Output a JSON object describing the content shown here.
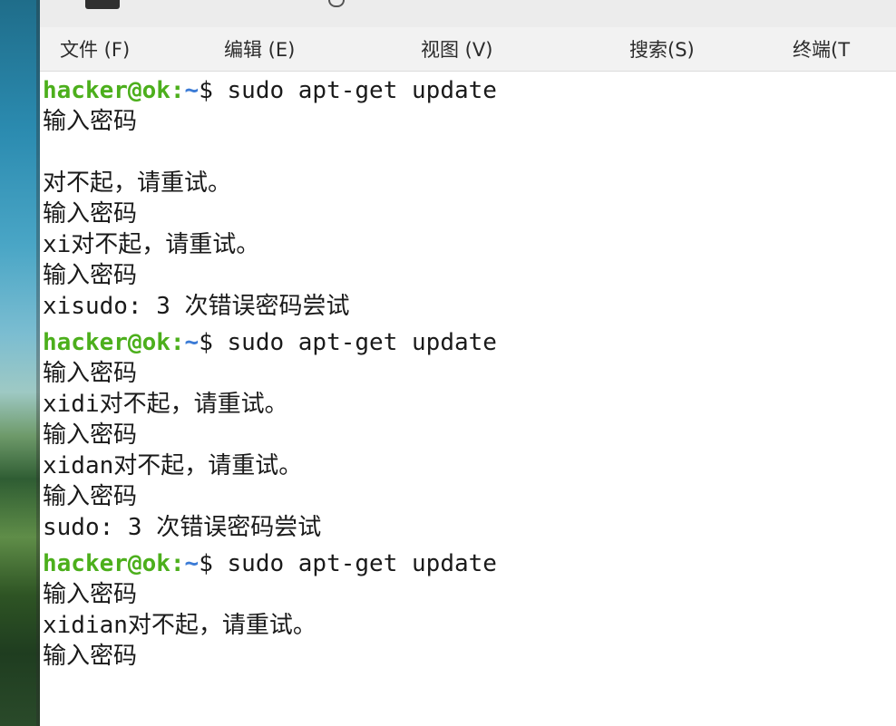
{
  "menubar": {
    "items": [
      {
        "label": "文件 (F)"
      },
      {
        "label": "编辑 (E)"
      },
      {
        "label": "视图 (V)"
      },
      {
        "label": "搜索(S)"
      },
      {
        "label": "终端(T"
      }
    ]
  },
  "terminal": {
    "prompt": {
      "user_host": "hacker@ok",
      "colon": ":",
      "path": "~",
      "sign": "$ "
    },
    "command": "sudo apt-get update",
    "lines": [
      "输入密码",
      "",
      "对不起，请重试。",
      "输入密码",
      "xi对不起，请重试。",
      "输入密码",
      "xisudo: 3 次错误密码尝试",
      "输入密码",
      "xidi对不起，请重试。",
      "输入密码",
      "xidan对不起，请重试。",
      "输入密码",
      "sudo: 3 次错误密码尝试",
      "输入密码",
      "xidian对不起，请重试。",
      "输入密码"
    ]
  },
  "colors": {
    "prompt_user": "#4caf1c",
    "prompt_path": "#3b7bd6",
    "text": "#1a1a1a",
    "background": "#ffffff"
  }
}
